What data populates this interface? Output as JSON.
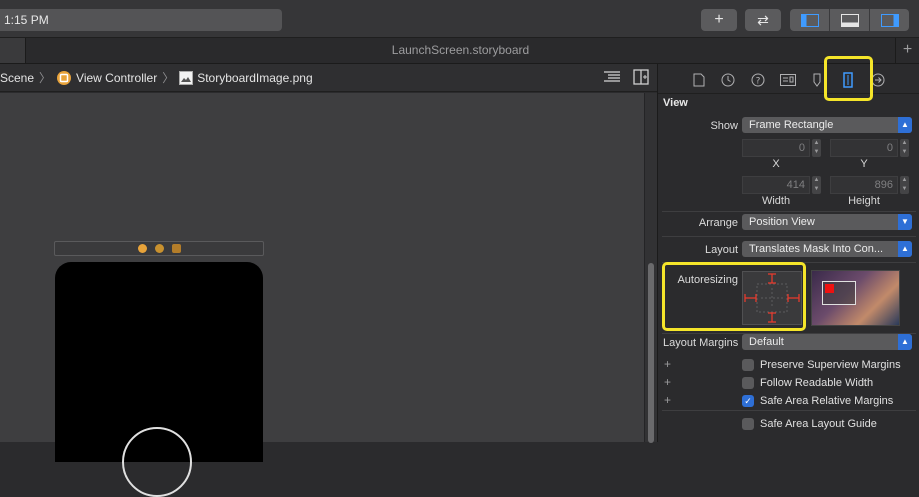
{
  "toolbar": {
    "status_text": "1:15 PM",
    "add_button": "+",
    "swap_button": "⇄"
  },
  "tabbar": {
    "title": "LaunchScreen.storyboard",
    "add": "+"
  },
  "jumpbar": {
    "crumbs": [
      "Scene",
      "View Controller",
      "StoryboardImage.png"
    ]
  },
  "inspector": {
    "section": "View",
    "show_label": "Show",
    "show_value": "Frame Rectangle",
    "x_value": "0",
    "y_value": "0",
    "x_label": "X",
    "y_label": "Y",
    "width_value": "414",
    "height_value": "896",
    "width_label": "Width",
    "height_label": "Height",
    "arrange_label": "Arrange",
    "arrange_value": "Position View",
    "layout_label": "Layout",
    "layout_value": "Translates Mask Into Con...",
    "autoresizing_label": "Autoresizing",
    "layout_margins_label": "Layout Margins",
    "layout_margins_value": "Default",
    "checkboxes": [
      {
        "label": "Preserve Superview Margins",
        "checked": false
      },
      {
        "label": "Follow Readable Width",
        "checked": false
      },
      {
        "label": "Safe Area Relative Margins",
        "checked": true
      },
      {
        "label": "Safe Area Layout Guide",
        "checked": false
      }
    ],
    "plus": "+"
  },
  "colors": {
    "highlight": "#f5e52a",
    "accent": "#2e6fd6",
    "strut": "#e53b2e"
  }
}
